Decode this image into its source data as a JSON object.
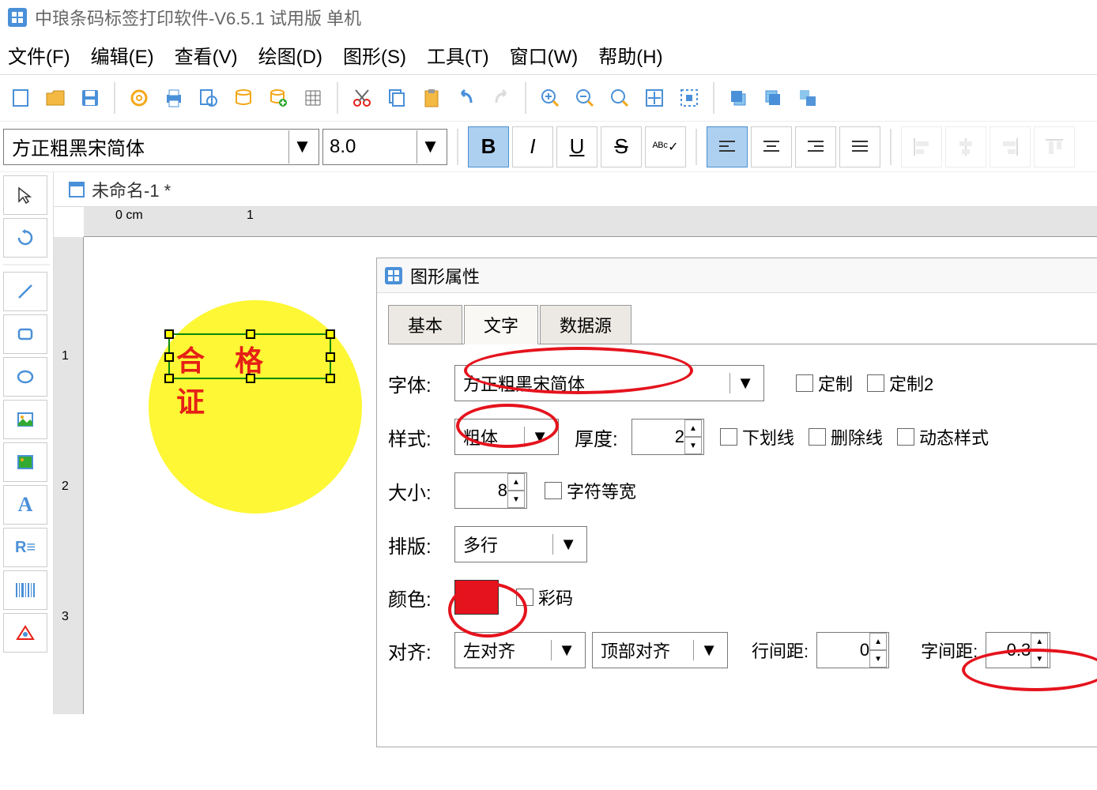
{
  "titlebar": {
    "text": "中琅条码标签打印软件-V6.5.1 试用版 单机"
  },
  "menubar": {
    "file": "文件(F)",
    "edit": "编辑(E)",
    "view": "查看(V)",
    "draw": "绘图(D)",
    "shape": "图形(S)",
    "tool": "工具(T)",
    "window": "窗口(W)",
    "help": "帮助(H)"
  },
  "formatbar": {
    "font": "方正粗黑宋简体",
    "size": "8.0"
  },
  "doc": {
    "name": "未命名-1 *"
  },
  "ruler": {
    "zero": "0 cm",
    "one": "1",
    "vone": "1",
    "vtwo": "2",
    "vthree": "3"
  },
  "sample_text": "合 格 证",
  "dialog": {
    "title": "图形属性",
    "tabs": {
      "basic": "基本",
      "text": "文字",
      "data": "数据源"
    },
    "font_label": "字体:",
    "font_value": "方正粗黑宋简体",
    "custom": "定制",
    "custom2": "定制2",
    "style_label": "样式:",
    "style_value": "粗体",
    "weight_label": "厚度:",
    "weight_value": "2",
    "underline": "下划线",
    "strike": "删除线",
    "dynamic": "动态样式",
    "size_label": "大小:",
    "size_value": "8",
    "monospace": "字符等宽",
    "layout_label": "排版:",
    "layout_value": "多行",
    "color_label": "颜色:",
    "colorcode": "彩码",
    "align_label": "对齐:",
    "halign": "左对齐",
    "valign": "顶部对齐",
    "linespace_label": "行间距:",
    "linespace_value": "0",
    "charspace_label": "字间距:",
    "charspace_value": "0.3"
  }
}
